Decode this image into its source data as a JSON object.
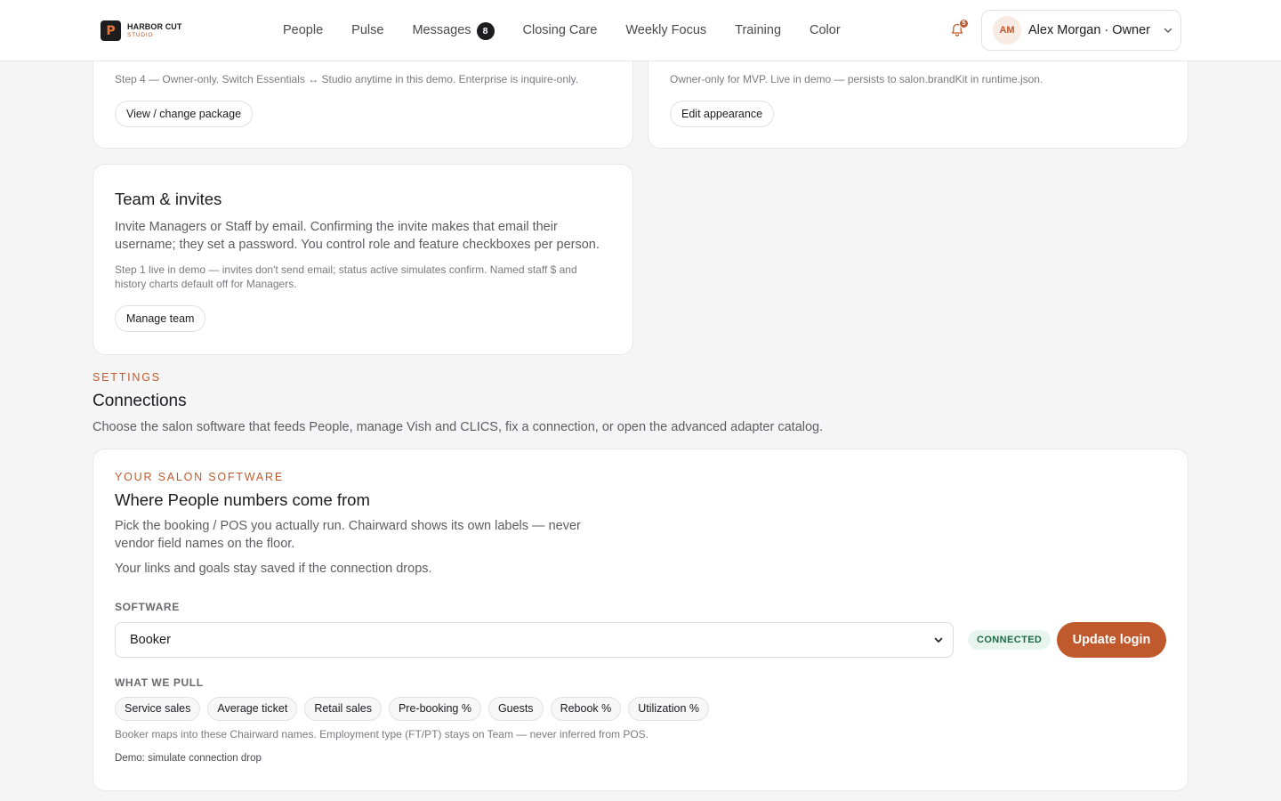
{
  "brand": {
    "mark": "P",
    "name": "HARBOR CUT",
    "sub": "STUDIO"
  },
  "nav": {
    "items": [
      "People",
      "Pulse",
      "Messages",
      "Closing Care",
      "Weekly Focus",
      "Training",
      "Color"
    ],
    "messages_count": "8"
  },
  "notifications": {
    "count": "5"
  },
  "account": {
    "initials": "AM",
    "name": "Alex Morgan · Owner"
  },
  "plan_card": {
    "note": "Step 4 — Owner-only. Switch Essentials ↔ Studio anytime in this demo. Enterprise is inquire-only.",
    "button": "View / change package"
  },
  "appearance_card": {
    "note": "Owner-only for MVP. Live in demo — persists to salon.brandKit in runtime.json.",
    "button": "Edit appearance"
  },
  "team_card": {
    "title": "Team & invites",
    "body": "Invite Managers or Staff by email. Confirming the invite makes that email their username; they set a password. You control role and feature checkboxes per person.",
    "note": "Step 1 live in demo — invites don't send email; status active simulates confirm. Named staff $ and history charts default off for Managers.",
    "button": "Manage team"
  },
  "settings": {
    "eyebrow": "SETTINGS",
    "title": "Connections",
    "desc": "Choose the salon software that feeds People, manage Vish and CLICS, fix a connection, or open the advanced adapter catalog."
  },
  "connection": {
    "eyebrow": "YOUR SALON SOFTWARE",
    "title": "Where People numbers come from",
    "body1": "Pick the booking / POS you actually run. Chairward shows its own labels — never vendor field names on the floor.",
    "body2": "Your links and goals stay saved if the connection drops.",
    "software_label": "SOFTWARE",
    "software_value": "Booker",
    "status": "CONNECTED",
    "update_button": "Update login",
    "pull_label": "WHAT WE PULL",
    "pulls": [
      "Service sales",
      "Average ticket",
      "Retail sales",
      "Pre-booking %",
      "Guests",
      "Rebook %",
      "Utilization %"
    ],
    "mapping_note": "Booker maps into these Chairward names. Employment type (FT/PT) stays on Team — never inferred from POS.",
    "demo_link": "Demo: simulate connection drop"
  },
  "colors": {
    "accent": "#c05a2c",
    "connected_bg": "#e8f5ef",
    "connected_fg": "#1e6b45"
  }
}
